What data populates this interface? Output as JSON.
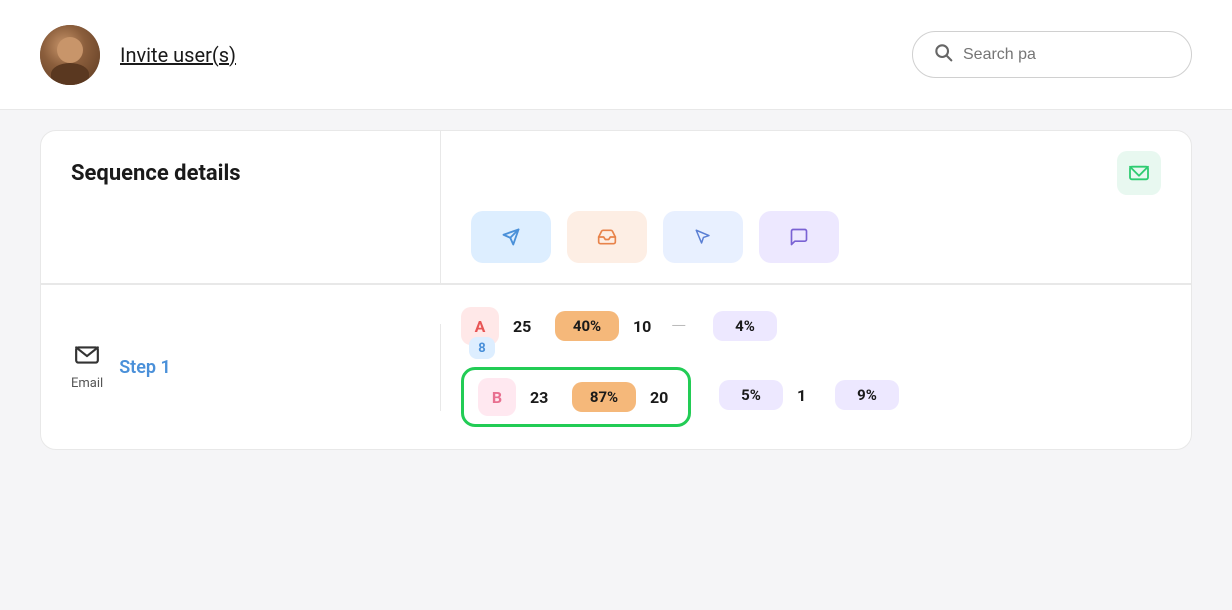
{
  "header": {
    "invite_label": "Invite user(s)",
    "search_placeholder": "Search pa"
  },
  "card": {
    "sequence_details_title": "Sequence details",
    "email_icon": "✉",
    "action_icons": [
      {
        "name": "send",
        "icon": "➤",
        "style": "blue"
      },
      {
        "name": "inbox",
        "icon": "📥",
        "style": "peach"
      },
      {
        "name": "cursor",
        "icon": "➤",
        "style": "light-blue"
      },
      {
        "name": "comment",
        "icon": "💬",
        "style": "lavender"
      }
    ]
  },
  "step": {
    "label": "Step 1",
    "type": "Email"
  },
  "variants": [
    {
      "letter": "A",
      "badge_style": "variant-a",
      "count": "25",
      "percent": "40%",
      "percent_style": "orange",
      "replied": "10",
      "bounced": "—",
      "unsubscribed": "4%",
      "unsubscribed_style": "stat-purple-badge"
    },
    {
      "letter": "B",
      "badge_style": "variant-b",
      "count": "23",
      "percent": "87%",
      "percent_style": "orange",
      "replied": "20",
      "unsubscribed_val": "5%",
      "extra": "1",
      "last_val": "9%",
      "highlighted": true
    }
  ],
  "variant_b_small_count": "8"
}
